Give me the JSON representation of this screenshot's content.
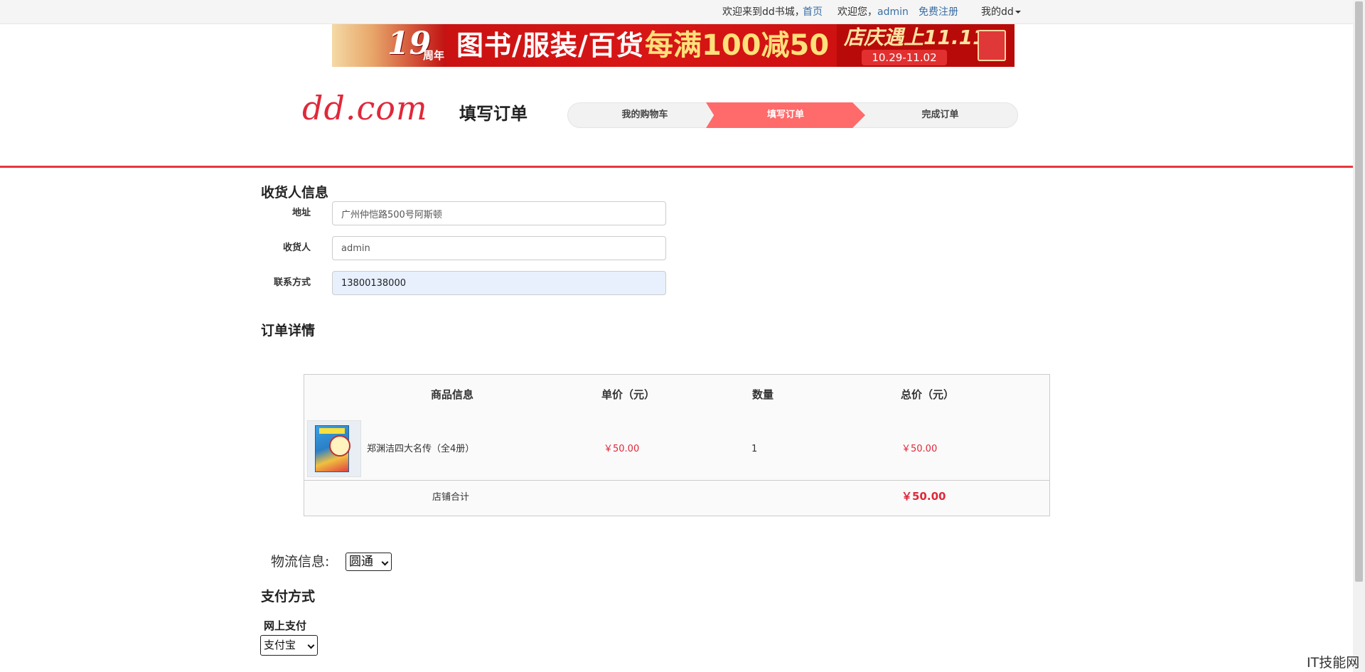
{
  "topbar": {
    "welcome": "欢迎来到dd书城，",
    "home": "首页",
    "greeting": "欢迎您，",
    "username": "admin",
    "register": "免费注册",
    "my_dd": "我的dd"
  },
  "banner": {
    "anniv_num": "19",
    "anniv_unit": "周年",
    "categories": "图书/服装/百货",
    "offer": "每满100减50",
    "festival": "店庆遇上11.11",
    "dates": "10.29-11.02"
  },
  "header": {
    "logo": "dd.com",
    "page_title": "填写订单",
    "steps": [
      "我的购物车",
      "填写订单",
      "完成订单"
    ]
  },
  "consignee": {
    "title": "收货人信息",
    "fields": [
      {
        "label": "地址",
        "value": "广州仲恺路500号阿斯顿"
      },
      {
        "label": "收货人",
        "value": "admin"
      },
      {
        "label": "联系方式",
        "value": "13800138000"
      }
    ]
  },
  "order": {
    "title": "订单详情",
    "columns": [
      "商品信息",
      "单价（元）",
      "数量",
      "总价（元）"
    ],
    "items": [
      {
        "name": "郑渊洁四大名传（全4册）",
        "unit_price": "￥50.00",
        "quantity": "1",
        "total": "￥50.00"
      }
    ],
    "store_total_label": "店铺合计",
    "store_total": "￥50.00"
  },
  "logistics": {
    "label": "物流信息:",
    "selected": "圆通"
  },
  "payment": {
    "title": "支付方式",
    "subtitle": "网上支付",
    "selected": "支付宝"
  },
  "watermark": "IT技能网",
  "colors": {
    "accent_red": "#e0283a",
    "step_active": "#ff6a6a",
    "link_blue": "#3a6ea5"
  }
}
